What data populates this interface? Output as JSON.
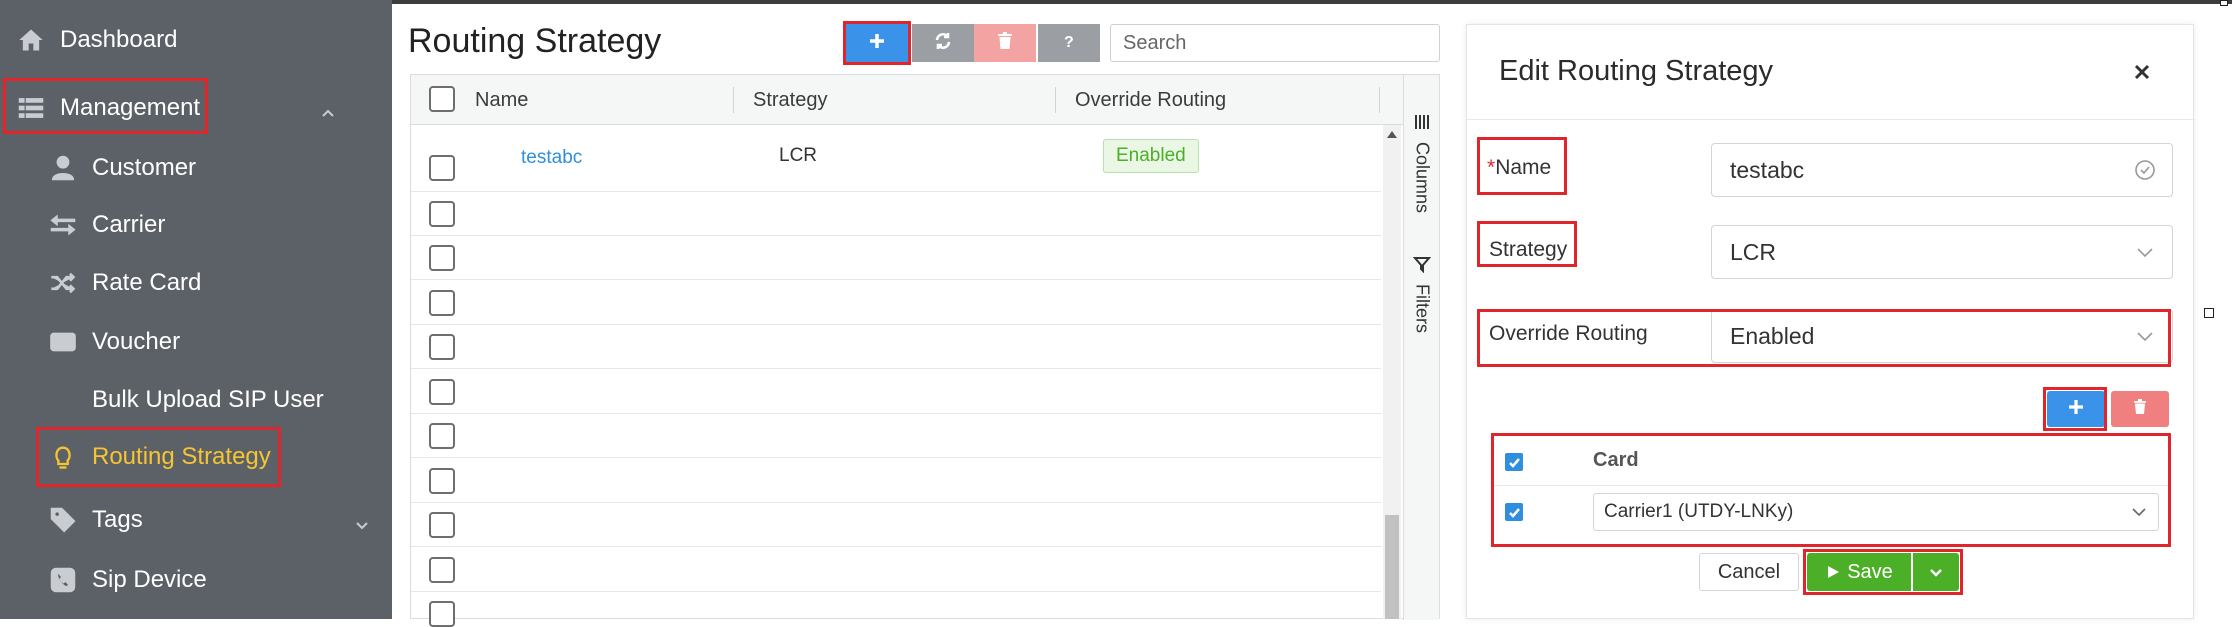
{
  "sidebar": {
    "items": [
      {
        "label": "Dashboard",
        "icon": "home-icon"
      },
      {
        "label": "Management",
        "icon": "list-icon"
      },
      {
        "label": "Customer",
        "icon": "user-icon"
      },
      {
        "label": "Carrier",
        "icon": "arrows-icon"
      },
      {
        "label": "Rate Card",
        "icon": "shuffle-icon"
      },
      {
        "label": "Voucher",
        "icon": "credit-card-icon"
      },
      {
        "label": "Bulk Upload SIP User",
        "icon": ""
      },
      {
        "label": "Routing Strategy",
        "icon": "lightbulb-icon"
      },
      {
        "label": "Tags",
        "icon": "tag-icon"
      },
      {
        "label": "Sip Device",
        "icon": "phone-icon"
      }
    ],
    "active_item": "Routing Strategy",
    "active_color": "#f7c531",
    "background": "#5c6168"
  },
  "page": {
    "title": "Routing Strategy",
    "toolbar": {
      "add_icon": "plus-icon",
      "refresh_icon": "refresh-icon",
      "delete_icon": "trash-icon",
      "help_icon": "question-icon"
    },
    "search_placeholder": "Search"
  },
  "grid": {
    "columns": [
      "Name",
      "Strategy",
      "Override Routing"
    ],
    "rows": [
      {
        "name": "testabc",
        "strategy": "LCR",
        "override_routing": "Enabled"
      }
    ],
    "side_tabs": [
      "Columns",
      "Filters"
    ]
  },
  "edit_panel": {
    "title": "Edit Routing Strategy",
    "fields": {
      "name_required_mark": "*",
      "name_label": "Name",
      "name_value": "testabc",
      "strategy_label": "Strategy",
      "strategy_value": "LCR",
      "override_label": "Override Routing",
      "override_value": "Enabled"
    },
    "card_table": {
      "header": "Card",
      "rows": [
        {
          "card": "Carrier1 (UTDY-LNKy)",
          "checked": true
        }
      ]
    },
    "buttons": {
      "cancel": "Cancel",
      "save": "Save"
    }
  },
  "colors": {
    "primary": "#2f8fde",
    "success": "#4caf28",
    "danger_light": "#f4a3a3",
    "highlight_box": "#e0262a"
  }
}
